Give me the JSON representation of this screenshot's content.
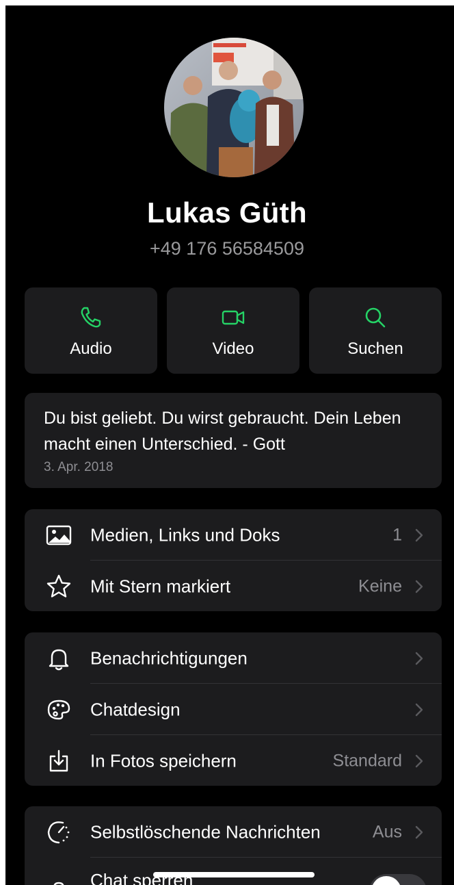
{
  "contact": {
    "name": "Lukas Güth",
    "phone": "+49 176 56584509"
  },
  "actions": [
    {
      "label": "Audio",
      "icon": "phone-icon"
    },
    {
      "label": "Video",
      "icon": "video-camera-icon"
    },
    {
      "label": "Suchen",
      "icon": "search-icon"
    }
  ],
  "about": {
    "text": "Du bist geliebt. Du wirst gebraucht. Dein Leben macht einen Unterschied.    - Gott",
    "date": "3. Apr. 2018"
  },
  "group1": [
    {
      "label": "Medien, Links und Doks",
      "value": "1",
      "icon": "photo-icon"
    },
    {
      "label": "Mit Stern markiert",
      "value": "Keine",
      "icon": "star-icon"
    }
  ],
  "group2": [
    {
      "label": "Benachrichtigungen",
      "value": "",
      "icon": "bell-icon"
    },
    {
      "label": "Chatdesign",
      "value": "",
      "icon": "palette-icon"
    },
    {
      "label": "In Fotos speichern",
      "value": "Standard",
      "icon": "download-icon"
    }
  ],
  "group3": [
    {
      "label": "Selbstlöschende Nachrichten",
      "value": "Aus",
      "icon": "timer-icon"
    },
    {
      "label": "Chat sperren",
      "value": "",
      "icon": "lock-icon",
      "toggle_on": false
    }
  ],
  "colors": {
    "accent": "#25d366",
    "background": "#000000",
    "card": "#1c1c1e",
    "secondary_text": "#8e8e93"
  }
}
